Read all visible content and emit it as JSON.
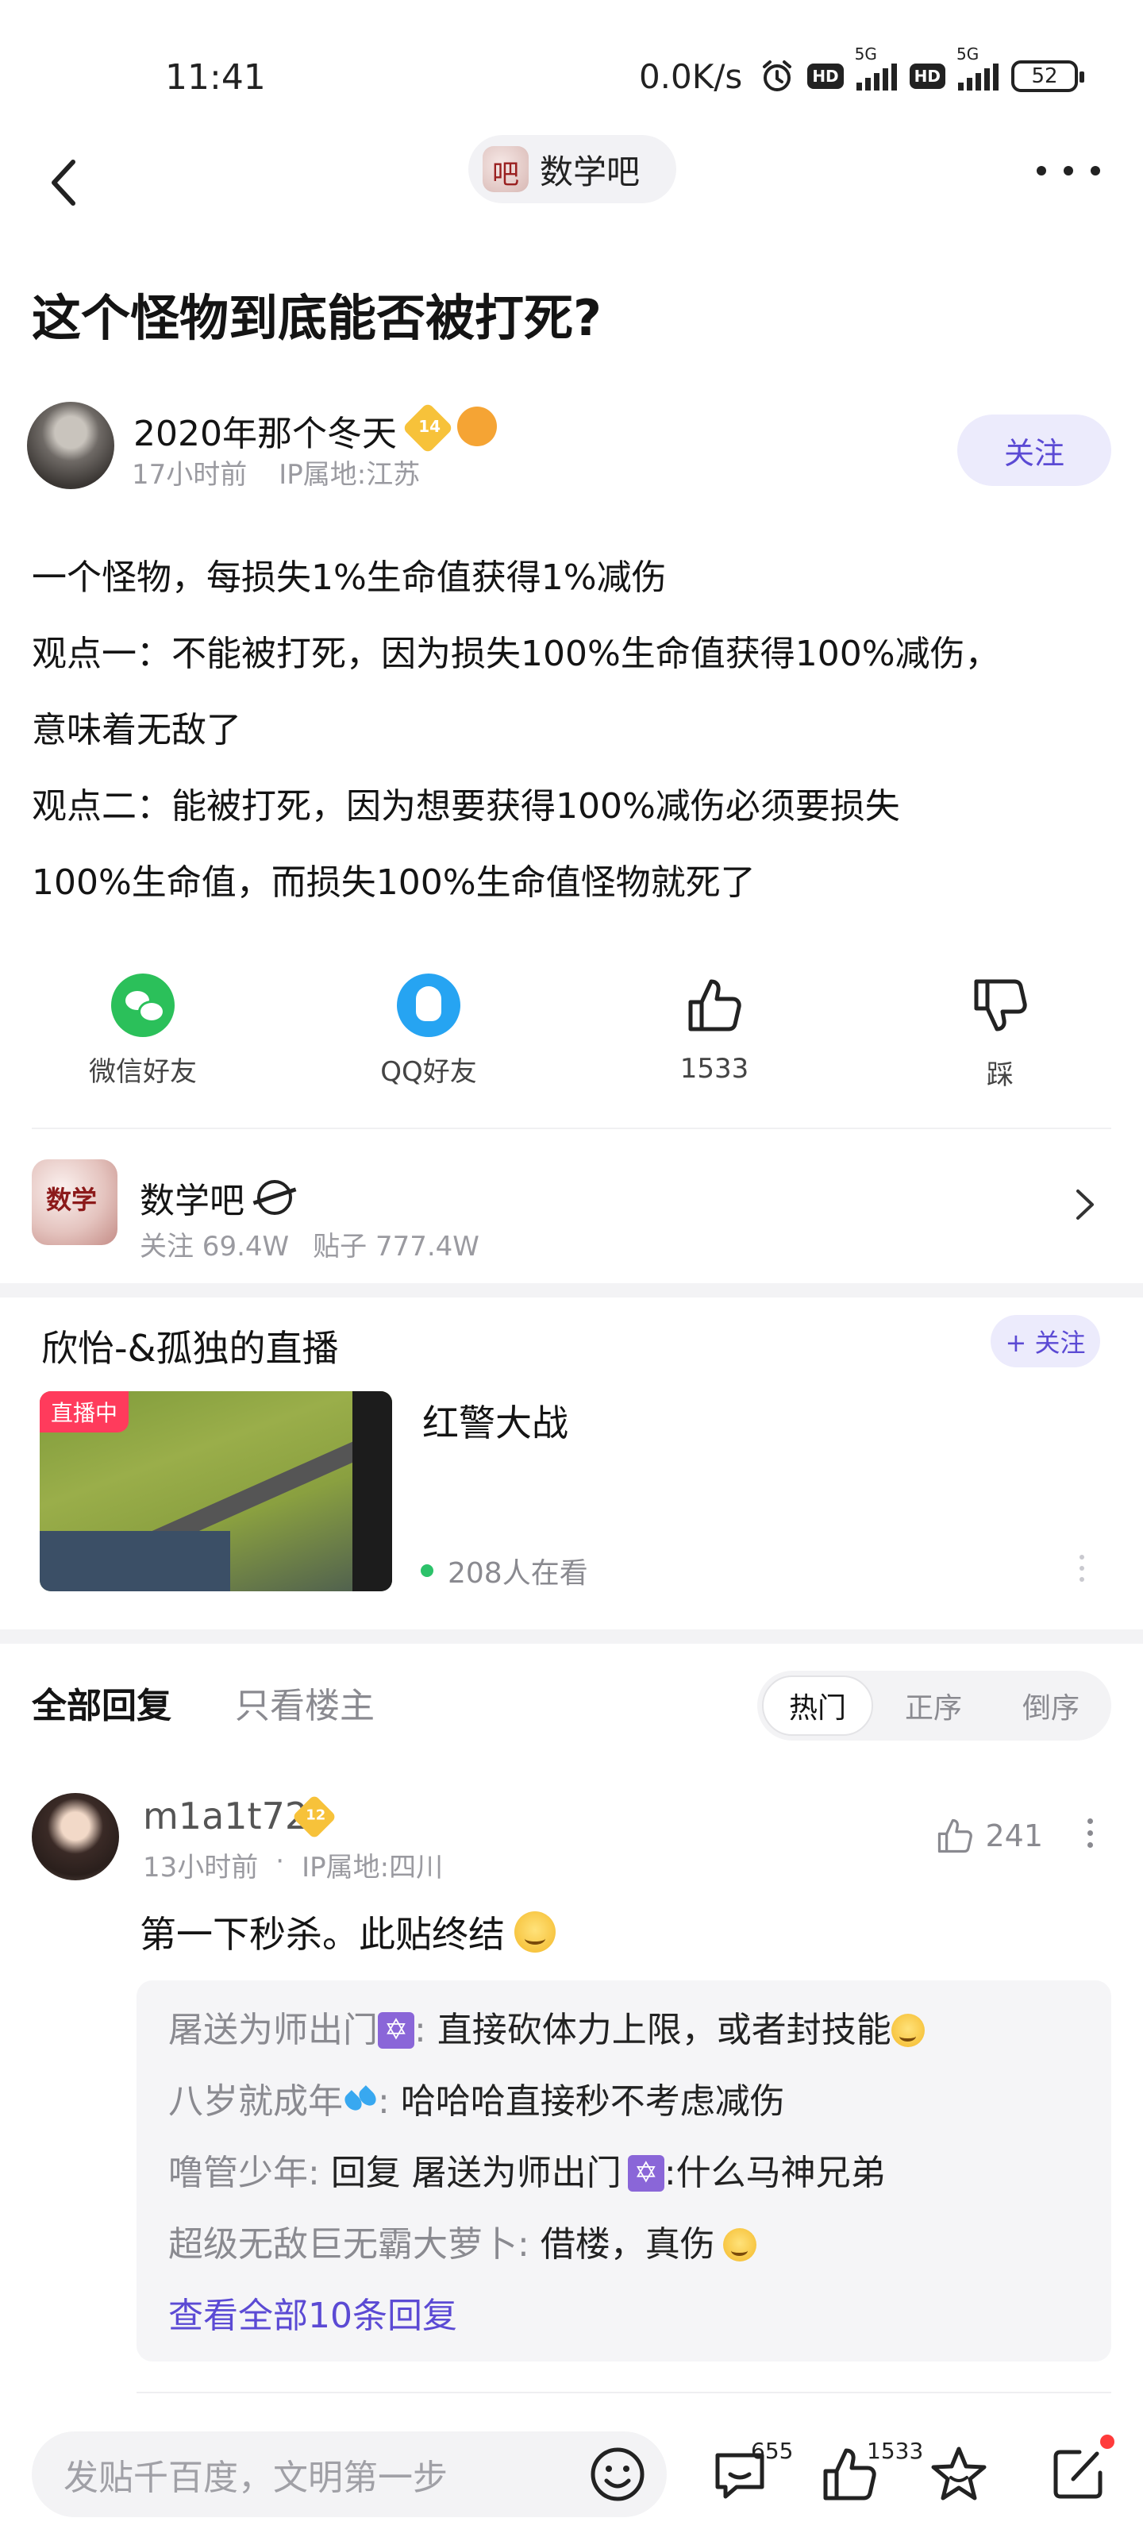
{
  "status_bar": {
    "time": "11:41",
    "network_speed": "0.0K/s",
    "hd_label": "HD",
    "network_type": "5G",
    "battery": "52"
  },
  "nav": {
    "forum_name": "数学吧"
  },
  "post": {
    "title": "这个怪物到底能否被打死?",
    "author": {
      "name": "2020年那个冬天",
      "level": "14",
      "time": "17小时前",
      "ip": "IP属地:江苏",
      "follow_label": "关注"
    },
    "body": [
      "一个怪物，每损失1%生命值获得1%减伤",
      "观点一：不能被打死，因为损失100%生命值获得100%减伤，",
      "意味着无敌了",
      "观点二：能被打死，因为想要获得100%减伤必须要损失",
      "100%生命值，而损失100%生命值怪物就死了"
    ],
    "actions": {
      "wechat": "微信好友",
      "qq": "QQ好友",
      "likes": "1533",
      "dislike": "踩"
    }
  },
  "forum_card": {
    "name": "数学吧",
    "followers": "关注 69.4W",
    "posts": "贴子 777.4W"
  },
  "live": {
    "title": "欣怡-&孤独的直播",
    "follow_label": "+ 关注",
    "badge": "直播中",
    "game": "红警大战",
    "viewers": "208人在看"
  },
  "replies": {
    "tab_all": "全部回复",
    "tab_lz": "只看楼主",
    "sort": [
      "热门",
      "正序",
      "倒序"
    ],
    "comments": [
      {
        "user": "m1a1t72",
        "level": "12",
        "time": "13小时前",
        "ip": "IP属地:四川",
        "likes": "241",
        "text": "第一下秒杀。此贴终结",
        "sub_replies": [
          {
            "user": "屠送为师出门",
            "text": "直接砍体力上限，或者封技能"
          },
          {
            "user": "八岁就成年",
            "text": "哈哈哈直接秒不考虑减伤"
          },
          {
            "user": "噜管少年",
            "text": "回复 屠送为师出门",
            "text2": ":什么马神兄弟"
          },
          {
            "user": "超级无敌巨无霸大萝卜",
            "text": "借楼，真伤"
          }
        ],
        "view_all": "查看全部10条回复"
      }
    ]
  },
  "bottom_bar": {
    "placeholder": "发贴千百度，文明第一步",
    "comment_count": "655",
    "like_count": "1533"
  },
  "colors": {
    "accent": "#5b4ad4",
    "wechat": "#2bc05a",
    "qq": "#26a4f2",
    "live_badge": "#ff3b5c",
    "level_badge": "#f7c23a"
  }
}
